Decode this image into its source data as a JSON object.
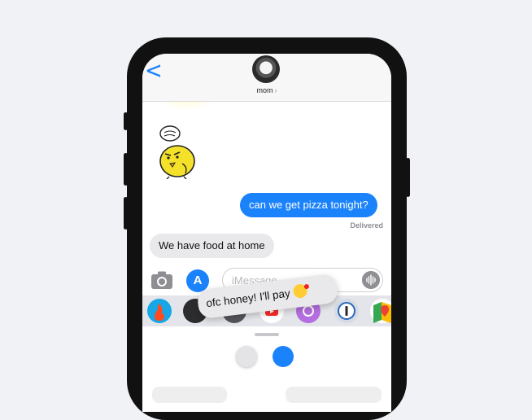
{
  "header": {
    "contact_name": "mom",
    "chevron": "›",
    "back_icon": "chevron-left-icon"
  },
  "messages": [
    {
      "type": "sticker",
      "from": "them",
      "icon": "angry-chick-sticker"
    },
    {
      "type": "text",
      "from": "me",
      "text": "can we get pizza tonight?"
    },
    {
      "type": "status",
      "text": "Delivered"
    },
    {
      "type": "text",
      "from": "them",
      "text": "We have food at home"
    }
  ],
  "composer": {
    "placeholder": "iMessage",
    "camera_icon": "camera-icon",
    "appstore_icon": "app-store-icon",
    "audio_icon": "audio-waveform-icon"
  },
  "app_tray": {
    "apps": [
      {
        "name": "fire-app-icon",
        "color": "#17a7e6"
      },
      {
        "name": "bitmoji-app-icon",
        "color": "#2c2c2e"
      },
      {
        "name": "camera-effects-app-icon",
        "color": "#55565c"
      },
      {
        "name": "youtube-app-icon",
        "color": "#ff2a2a"
      },
      {
        "name": "music-app-icon",
        "color": "#b46ee0"
      },
      {
        "name": "onepassword-app-icon",
        "color": "#2a69b8"
      },
      {
        "name": "google-maps-app-icon",
        "color": "#34a853"
      }
    ]
  },
  "floating_bubble": {
    "text": "ofc honey! I'll pay",
    "emoji_icon": "face-blowing-kiss-icon"
  },
  "colors": {
    "accent": "#1a82fb",
    "incoming_bubble": "#e9e9eb",
    "background": "#f0f2f6"
  }
}
